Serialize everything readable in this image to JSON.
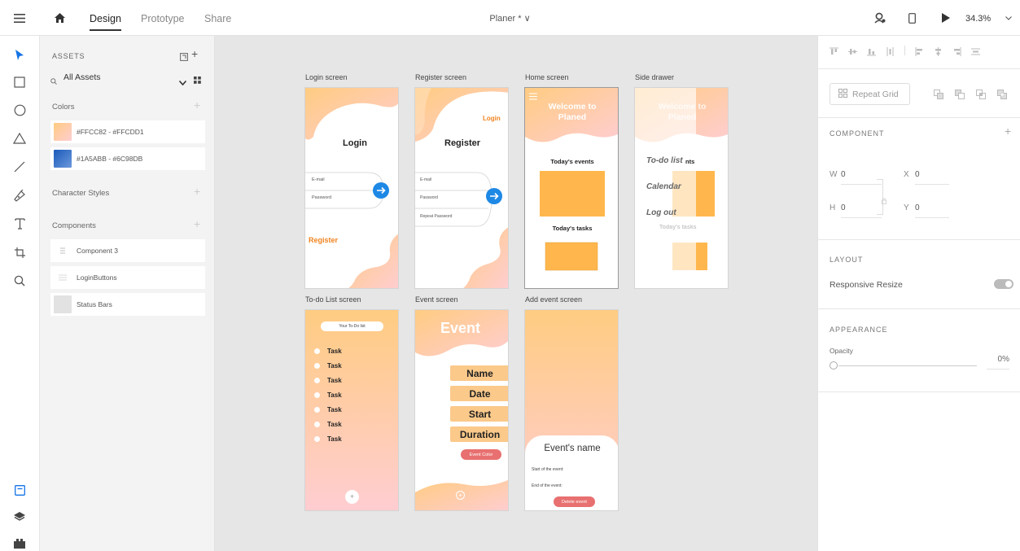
{
  "topbar": {
    "tabs": [
      {
        "label": "Design"
      },
      {
        "label": "Prototype"
      },
      {
        "label": "Share"
      }
    ],
    "doc_title": "Planer * ∨",
    "zoom": "34.3%",
    "icons": [
      "hamburger-icon",
      "home-icon",
      "user-icon",
      "device-icon",
      "play-icon",
      "chevron-down-icon"
    ]
  },
  "tools": [
    "select-icon",
    "rectangle-icon",
    "ellipse-icon",
    "triangle-icon",
    "line-icon",
    "pen-icon",
    "text-icon",
    "artboard-icon",
    "zoom-icon",
    "assets-panel-icon",
    "layers-icon",
    "plugins-icon"
  ],
  "assets": {
    "title": "ASSETS",
    "filter": "All Assets",
    "colors_label": "Colors",
    "colors": [
      {
        "name": "#FFCC82 - #FFCDD1",
        "from": "#FFCC82",
        "to": "#FFCDD1"
      },
      {
        "name": "#1A5ABB - #6C98DB",
        "from": "#1A5ABB",
        "to": "#6C98DB"
      }
    ],
    "char_styles_label": "Character Styles",
    "components_label": "Components",
    "components": [
      {
        "name": "Component 3"
      },
      {
        "name": "LoginButtons"
      },
      {
        "name": "Status Bars"
      }
    ]
  },
  "artboards": {
    "login": {
      "label": "Login screen",
      "title": "Login",
      "email": "E-mail",
      "password": "Password",
      "register_link": "Register"
    },
    "register": {
      "label": "Register screen",
      "title": "Register",
      "login_link": "Login",
      "email": "E-mail",
      "password": "Password",
      "repeat": "Repeat Password"
    },
    "home": {
      "label": "Home screen",
      "welcome": "Welcome to Planed",
      "events": "Today's events",
      "tasks": "Today's tasks"
    },
    "drawer": {
      "label": "Side drawer",
      "welcome": "Welcome to Planed",
      "items": [
        "To-do list",
        "Calendar",
        "Log out"
      ],
      "events_tail": "nts",
      "tasks_ghost": "Today's tasks"
    },
    "todo": {
      "label": "To-do List screen",
      "header": "Your To-Do list",
      "tasks": [
        "Task",
        "Task",
        "Task",
        "Task",
        "Task",
        "Task",
        "Task"
      ],
      "add": "+"
    },
    "event": {
      "label": "Event screen",
      "title": "Event",
      "fields": [
        "Name",
        "Date",
        "Start",
        "Duration"
      ],
      "color_btn": "Event Color",
      "add": "+"
    },
    "add_event": {
      "label": "Add event screen",
      "name": "Event's name",
      "start": "Start of the event:",
      "end": "End of the event:",
      "delete": "Delete event"
    }
  },
  "props": {
    "repeat_grid": "Repeat Grid",
    "component_label": "COMPONENT",
    "w_label": "W",
    "w": "0",
    "h_label": "H",
    "h": "0",
    "x_label": "X",
    "x": "0",
    "y_label": "Y",
    "y": "0",
    "layout_label": "LAYOUT",
    "responsive_resize": "Responsive Resize",
    "appearance_label": "APPEARANCE",
    "opacity_label": "Opacity",
    "opacity": "0%"
  },
  "colors": {
    "accent": "#1473e6",
    "peach": "#FFCC82",
    "pink": "#FFCDD1",
    "field": "#FBC98A",
    "red": "#E87070",
    "login_orange": "#F0831E"
  }
}
